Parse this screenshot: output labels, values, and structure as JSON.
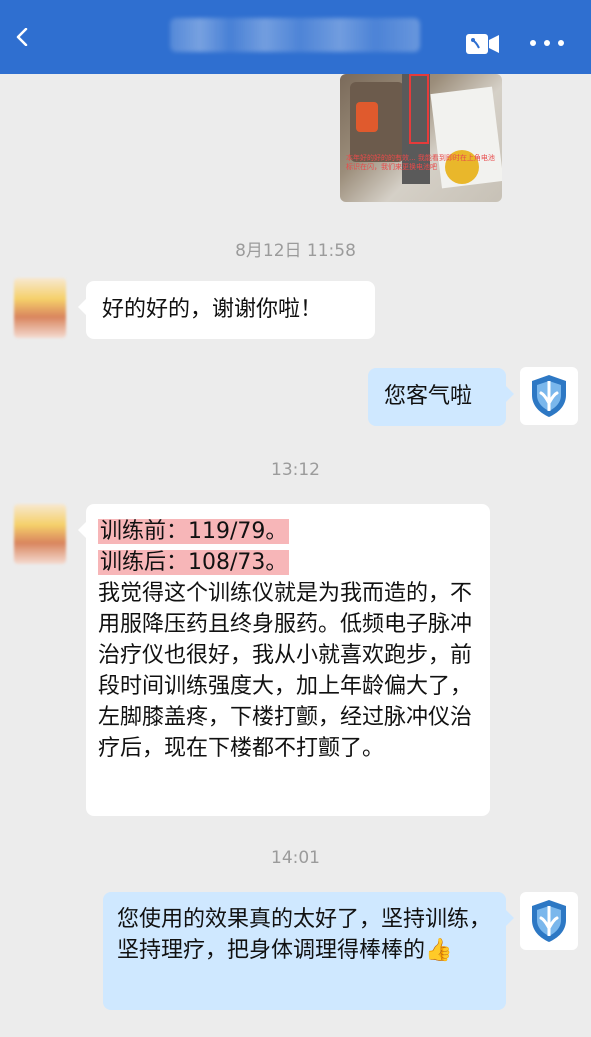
{
  "header": {
    "contact_name": ""
  },
  "messages": [
    {
      "type": "image",
      "side": "right",
      "caption": "本年好的好的的有效... 我能看到即时在上角电池标识在闪，我们来更换电池吧"
    },
    {
      "type": "time",
      "text": "8月12日 11:58"
    },
    {
      "type": "text",
      "side": "left",
      "text": "好的好的，谢谢你啦！"
    },
    {
      "type": "text",
      "side": "right",
      "text": "您客气啦"
    },
    {
      "type": "time",
      "text": "13:12"
    },
    {
      "type": "text",
      "side": "left",
      "highlight_lines": [
        "训练前：119/79。",
        "训练后：108/73。"
      ],
      "text": "我觉得这个训练仪就是为我而造的，不用服降压药且终身服药。低频电子脉冲治疗仪也很好，我从小就喜欢跑步，前段时间训练强度大，加上年龄偏大了，左脚膝盖疼，下楼打颤，经过脉冲仪治疗后，现在下楼都不打颤了。"
    },
    {
      "type": "time",
      "text": "14:01"
    },
    {
      "type": "text",
      "side": "right",
      "text": "您使用的效果真的太好了，坚持训练，坚持理疗，把身体调理得棒棒的",
      "emoji": "👍"
    }
  ],
  "icons": {
    "back": "chevron-left-icon",
    "video": "video-call-icon",
    "more": "more-icon",
    "agent_avatar": "shield-icon"
  },
  "colors": {
    "topbar": "#2f6fd0",
    "background": "#ececec",
    "bubble_right": "#cfe8ff",
    "bubble_left": "#ffffff",
    "highlight": "#f7b6b8",
    "time_text": "#9b9b9b"
  }
}
